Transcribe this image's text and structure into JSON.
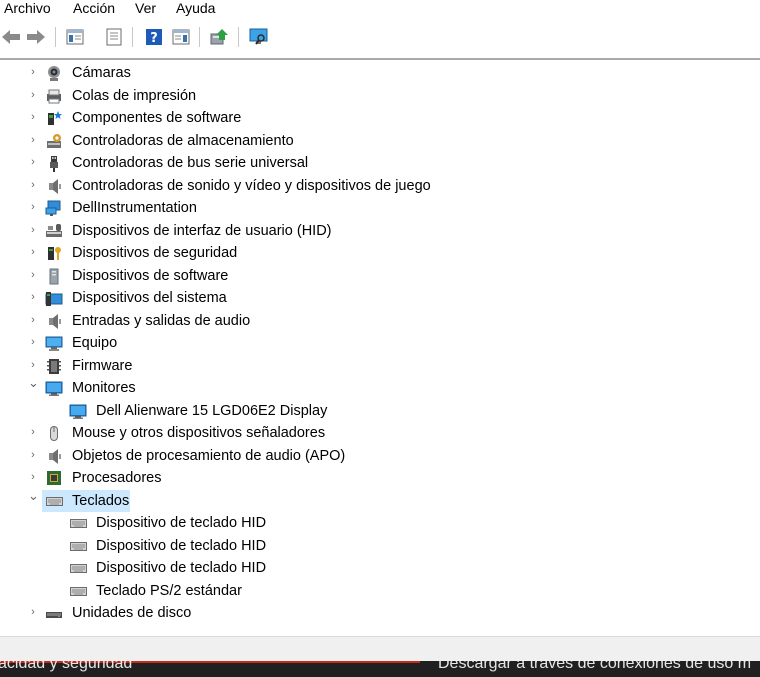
{
  "menu": {
    "items": [
      {
        "label": "Archivo"
      },
      {
        "label": "Acción"
      },
      {
        "label": "Ver"
      },
      {
        "label": "Ayuda"
      }
    ]
  },
  "toolbar": {
    "buttons": [
      {
        "icon": "back-arrow-icon"
      },
      {
        "icon": "forward-arrow-icon"
      },
      {
        "icon": "show-hide-console-tree-icon"
      },
      {
        "icon": "properties-icon"
      },
      {
        "icon": "help-icon"
      },
      {
        "icon": "action-pane-icon"
      },
      {
        "icon": "update-driver-icon"
      },
      {
        "icon": "scan-hardware-icon"
      }
    ]
  },
  "tree": {
    "items": [
      {
        "label": "Cámaras",
        "icon": "camera-icon",
        "expanded": false,
        "level": 1
      },
      {
        "label": "Colas de impresión",
        "icon": "printer-icon",
        "expanded": false,
        "level": 1
      },
      {
        "label": "Componentes de software",
        "icon": "software-component-icon",
        "expanded": false,
        "level": 1
      },
      {
        "label": "Controladoras de almacenamiento",
        "icon": "storage-controller-icon",
        "expanded": false,
        "level": 1
      },
      {
        "label": "Controladoras de bus serie universal",
        "icon": "usb-icon",
        "expanded": false,
        "level": 1
      },
      {
        "label": "Controladoras de sonido y vídeo y dispositivos de juego",
        "icon": "speaker-icon",
        "expanded": false,
        "level": 1
      },
      {
        "label": "DellInstrumentation",
        "icon": "network-monitor-icon",
        "expanded": false,
        "level": 1
      },
      {
        "label": "Dispositivos de interfaz de usuario (HID)",
        "icon": "hid-icon",
        "expanded": false,
        "level": 1
      },
      {
        "label": "Dispositivos de seguridad",
        "icon": "security-key-icon",
        "expanded": false,
        "level": 1
      },
      {
        "label": "Dispositivos de software",
        "icon": "software-device-icon",
        "expanded": false,
        "level": 1
      },
      {
        "label": "Dispositivos del sistema",
        "icon": "system-device-icon",
        "expanded": false,
        "level": 1
      },
      {
        "label": "Entradas y salidas de audio",
        "icon": "speaker-icon",
        "expanded": false,
        "level": 1
      },
      {
        "label": "Equipo",
        "icon": "computer-icon",
        "expanded": false,
        "level": 1
      },
      {
        "label": "Firmware",
        "icon": "firmware-icon",
        "expanded": false,
        "level": 1
      },
      {
        "label": "Monitores",
        "icon": "monitor-icon",
        "expanded": true,
        "level": 1
      },
      {
        "label": "Dell Alienware 15 LGD06E2 Display",
        "icon": "monitor-icon",
        "level": 2
      },
      {
        "label": "Mouse y otros dispositivos señaladores",
        "icon": "mouse-icon",
        "expanded": false,
        "level": 1
      },
      {
        "label": "Objetos de procesamiento de audio (APO)",
        "icon": "speaker-icon",
        "expanded": false,
        "level": 1
      },
      {
        "label": "Procesadores",
        "icon": "processor-icon",
        "expanded": false,
        "level": 1
      },
      {
        "label": "Teclados",
        "icon": "keyboard-icon",
        "expanded": true,
        "level": 1,
        "selected": true
      },
      {
        "label": "Dispositivo de teclado HID",
        "icon": "keyboard-icon",
        "level": 2
      },
      {
        "label": "Dispositivo de teclado HID",
        "icon": "keyboard-icon",
        "level": 2
      },
      {
        "label": "Dispositivo de teclado HID",
        "icon": "keyboard-icon",
        "level": 2
      },
      {
        "label": "Teclado PS/2 estándar",
        "icon": "keyboard-icon",
        "level": 2
      },
      {
        "label": "Unidades de disco",
        "icon": "disk-drive-icon",
        "expanded": false,
        "level": 1
      }
    ]
  },
  "taskbar": {
    "left_text": "acidad y seguridad",
    "right_text": "Descargar a través de conexiones de uso m"
  }
}
